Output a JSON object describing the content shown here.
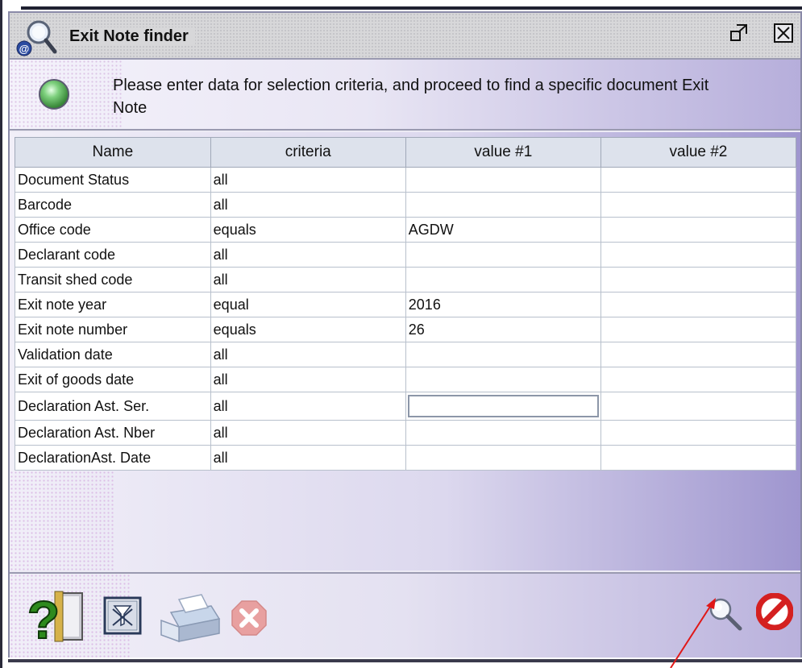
{
  "window": {
    "title": "Exit Note finder"
  },
  "banner": {
    "message": "Please enter data for selection criteria, and proceed to find a specific document Exit Note"
  },
  "table": {
    "columns": [
      "Name",
      "criteria",
      "value #1",
      "value #2"
    ],
    "rows": [
      {
        "name": "Document Status",
        "criteria": "all",
        "value1": "",
        "value2": ""
      },
      {
        "name": "Barcode",
        "criteria": "all",
        "value1": "",
        "value2": ""
      },
      {
        "name": "Office code",
        "criteria": "equals",
        "value1": "AGDW",
        "value2": ""
      },
      {
        "name": "Declarant code",
        "criteria": "all",
        "value1": "",
        "value2": ""
      },
      {
        "name": "Transit shed code",
        "criteria": "all",
        "value1": "",
        "value2": ""
      },
      {
        "name": "Exit note year",
        "criteria": "equal",
        "value1": "2016",
        "value2": ""
      },
      {
        "name": "Exit note number",
        "criteria": "equals",
        "value1": "26",
        "value2": ""
      },
      {
        "name": "Validation date",
        "criteria": "all",
        "value1": "",
        "value2": ""
      },
      {
        "name": "Exit of goods date",
        "criteria": "all",
        "value1": "",
        "value2": ""
      },
      {
        "name": "Declaration Ast. Ser.",
        "criteria": "all",
        "value1": "",
        "value2": ""
      },
      {
        "name": "Declaration Ast. Nber",
        "criteria": "all",
        "value1": "",
        "value2": ""
      },
      {
        "name": "DeclarationAst. Date",
        "criteria": "all",
        "value1": "",
        "value2": ""
      }
    ]
  },
  "icons": {
    "title": "search-icon",
    "restore": "restore-window-icon",
    "close": "close-window-icon",
    "status": "green-status-led-icon",
    "help": "help-icon",
    "clear": "clear-filter-icon",
    "print": "printer-icon",
    "cancel": "cancel-icon",
    "find": "find-icon",
    "stop": "stop-icon"
  },
  "colors": {
    "accent": "#9f96cf",
    "status_led": "#4caf50",
    "stop": "#d42020",
    "cancel_disabled": "#e8a0a0"
  }
}
